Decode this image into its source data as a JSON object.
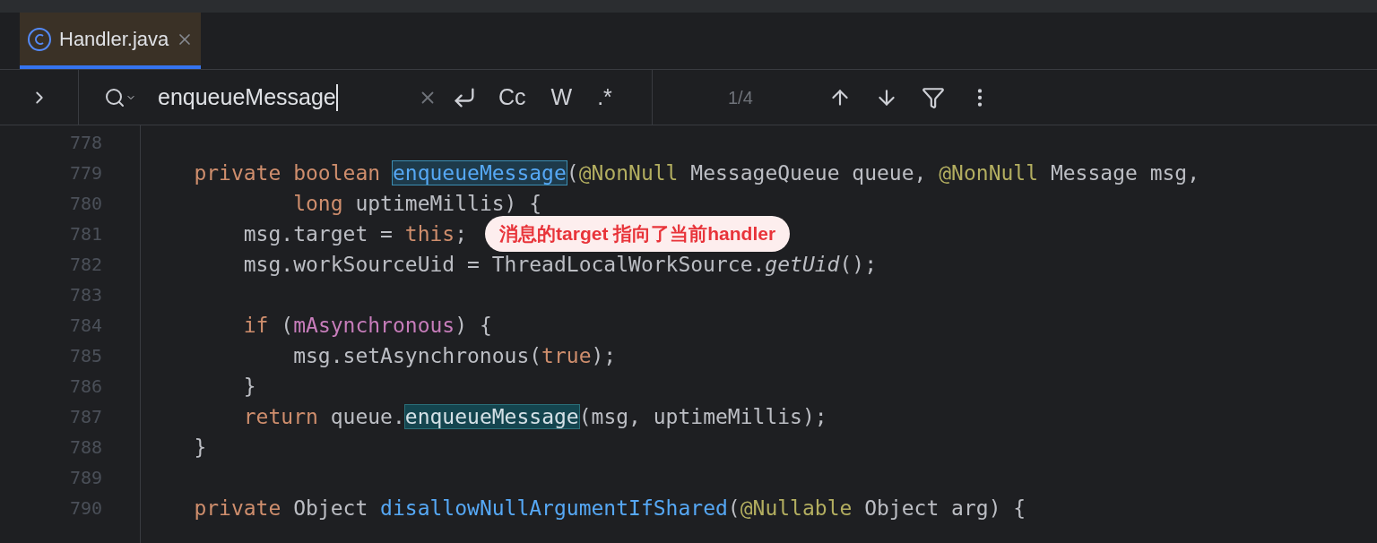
{
  "tabs": [
    {
      "label": "Handler.java",
      "selected": true
    }
  ],
  "search": {
    "value": "enqueueMessage",
    "options": [
      {
        "label": "Cc",
        "on": false
      },
      {
        "label": "W",
        "on": false
      },
      {
        "label": ".*",
        "on": false
      }
    ],
    "count": "1/4"
  },
  "code": [
    {
      "number": "778"
    },
    {
      "number": "779",
      "tokens": [
        {
          "text": "    private boolean ",
          "kind": "kw"
        },
        {
          "text": "enqueueMessage",
          "kind": "current"
        },
        {
          "text": "(",
          "kind": "plain"
        },
        {
          "text": "@NonNull",
          "kind": "ann"
        },
        {
          "text": " MessageQueue queue, ",
          "kind": "plain"
        },
        {
          "text": "@NonNull",
          "kind": "ann"
        },
        {
          "text": " Message msg,",
          "kind": "plain"
        }
      ]
    },
    {
      "number": "780",
      "tokens": [
        {
          "text": "            long ",
          "kind": "kw"
        },
        {
          "text": "uptimeMillis) {",
          "kind": "plain"
        }
      ]
    },
    {
      "number": "781",
      "tokens": [
        {
          "text": "        msg.target = ",
          "kind": "plain"
        },
        {
          "text": "this",
          "kind": "kw"
        },
        {
          "text": ";",
          "kind": "plain"
        }
      ],
      "callout": "消息的target 指向了当前handler"
    },
    {
      "number": "782",
      "tokens": [
        {
          "text": "        msg.workSourceUid = ThreadLocalWorkSource.",
          "kind": "plain"
        },
        {
          "text": "getUid",
          "kind": "static"
        },
        {
          "text": "();",
          "kind": "plain"
        }
      ]
    },
    {
      "number": "783"
    },
    {
      "number": "784",
      "tokens": [
        {
          "text": "        if ",
          "kind": "kw"
        },
        {
          "text": "(",
          "kind": "plain"
        },
        {
          "text": "mAsynchronous",
          "kind": "field"
        },
        {
          "text": ") {",
          "kind": "plain"
        }
      ]
    },
    {
      "number": "785",
      "tokens": [
        {
          "text": "            msg.setAsynchronous(",
          "kind": "plain"
        },
        {
          "text": "true",
          "kind": "kw"
        },
        {
          "text": ");",
          "kind": "plain"
        }
      ]
    },
    {
      "number": "786",
      "tokens": [
        {
          "text": "        }",
          "kind": "plain"
        }
      ]
    },
    {
      "number": "787",
      "tokens": [
        {
          "text": "        return ",
          "kind": "kw"
        },
        {
          "text": "queue.",
          "kind": "plain"
        },
        {
          "text": "enqueueMessage",
          "kind": "match"
        },
        {
          "text": "(msg, uptimeMillis);",
          "kind": "plain"
        }
      ]
    },
    {
      "number": "788",
      "tokens": [
        {
          "text": "    }",
          "kind": "plain"
        }
      ]
    },
    {
      "number": "789"
    },
    {
      "number": "790",
      "tokens": [
        {
          "text": "    private ",
          "kind": "kw"
        },
        {
          "text": "Object ",
          "kind": "plain"
        },
        {
          "text": "disallowNullArgumentIfShared",
          "kind": "decl"
        },
        {
          "text": "(",
          "kind": "plain"
        },
        {
          "text": "@Nullable",
          "kind": "ann"
        },
        {
          "text": " Object arg) {",
          "kind": "plain"
        }
      ]
    }
  ]
}
